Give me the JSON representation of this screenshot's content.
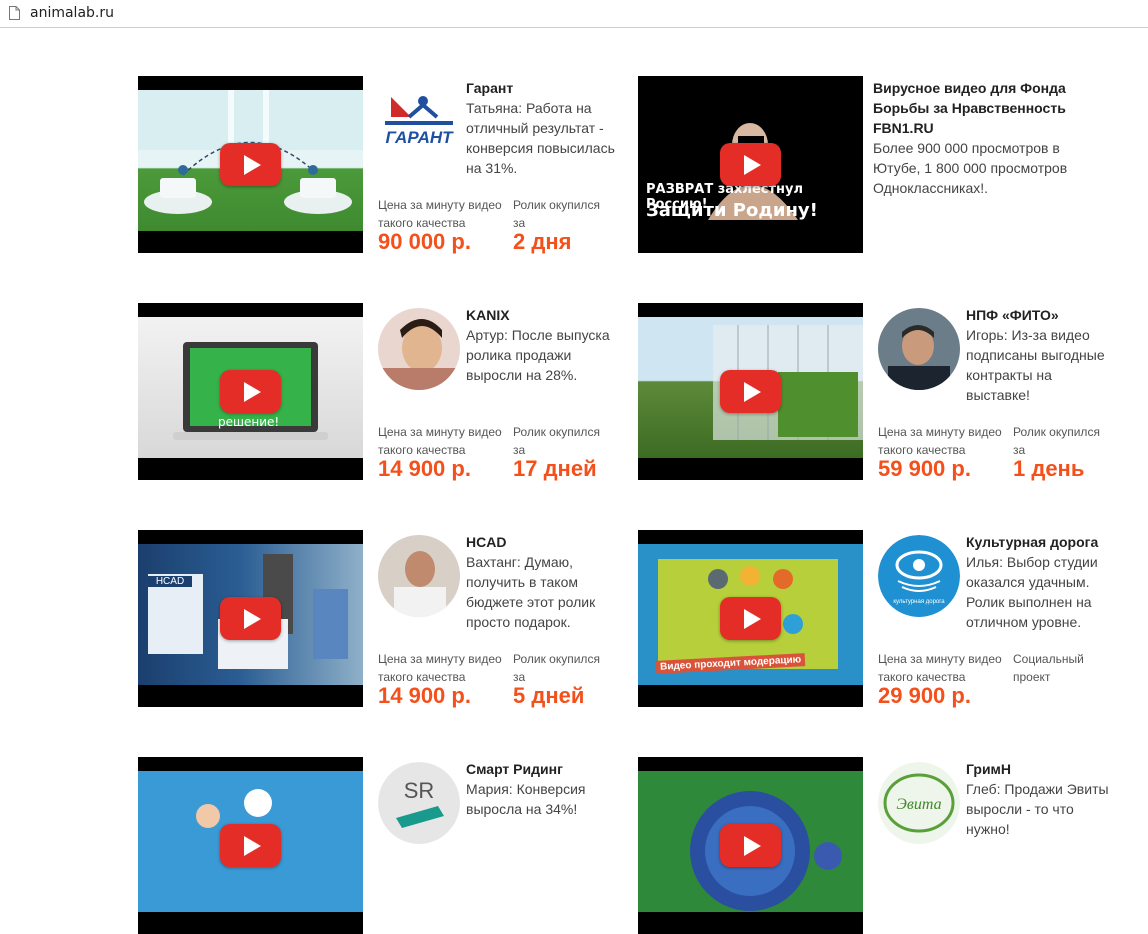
{
  "browser": {
    "url": "animalab.ru"
  },
  "cards": [
    {
      "title": "Гарант",
      "text": "Татьяна: Работа на отличный результат - конверсия повысилась на 31%.",
      "price_label": "Цена за минуту видео такого качества",
      "price": "90 000 р.",
      "payback_label": "Ролик окупился за",
      "payback": "2 дня",
      "logo_text": "ГАРАНТ"
    },
    {
      "title": "Вирусное видео для Фонда Борьбы за Нравственность FBN1.RU",
      "text": "Более 900 000 просмотров в Ютубе, 1 800 000 просмотров Одноклассниках!.",
      "video_caption_1": "РАЗВРАТ захлестнул Россию!",
      "video_caption_2": "Защити Родину!"
    },
    {
      "title": "KANIX",
      "text": "Артур: После выпуска ролика продажи выросли на 28%.",
      "price_label": "Цена за минуту видео такого качества",
      "price": "14 900 р.",
      "payback_label": "Ролик окупился за",
      "payback": "17 дней",
      "video_caption": "решение!"
    },
    {
      "title": "НПФ «ФИТО»",
      "text": "Игорь: Из-за видео подписаны выгодные контракты на выставке!",
      "price_label": "Цена за минуту видео такого качества",
      "price": "59 900 р.",
      "payback_label": "Ролик окупился за",
      "payback": "1 день"
    },
    {
      "title": "HCAD",
      "text": "Вахтанг: Думаю, получить в таком бюджете этот ролик просто подарок.",
      "price_label": "Цена за минуту видео такого качества",
      "price": "14 900 р.",
      "payback_label": "Ролик окупился за",
      "payback": "5 дней",
      "video_caption": "HCAD"
    },
    {
      "title": "Культурная дорога",
      "text": "Илья: Выбор студии оказался удачным. Ролик выполнен на отличном уровне.",
      "price_label": "Цена за минуту видео такого качества",
      "price": "29 900 р.",
      "payback_label": "Социальный проект",
      "logo_text": "культурная дорога",
      "video_caption": "Видео проходит модерацию"
    },
    {
      "title": "Смарт Ридинг",
      "text": "Мария: Конверсия выросла на 34%!",
      "logo_text": "SR"
    },
    {
      "title": "ГримН",
      "text": "Глеб: Продажи Эвиты выросли - то что нужно!",
      "logo_text": "Эвита"
    }
  ]
}
